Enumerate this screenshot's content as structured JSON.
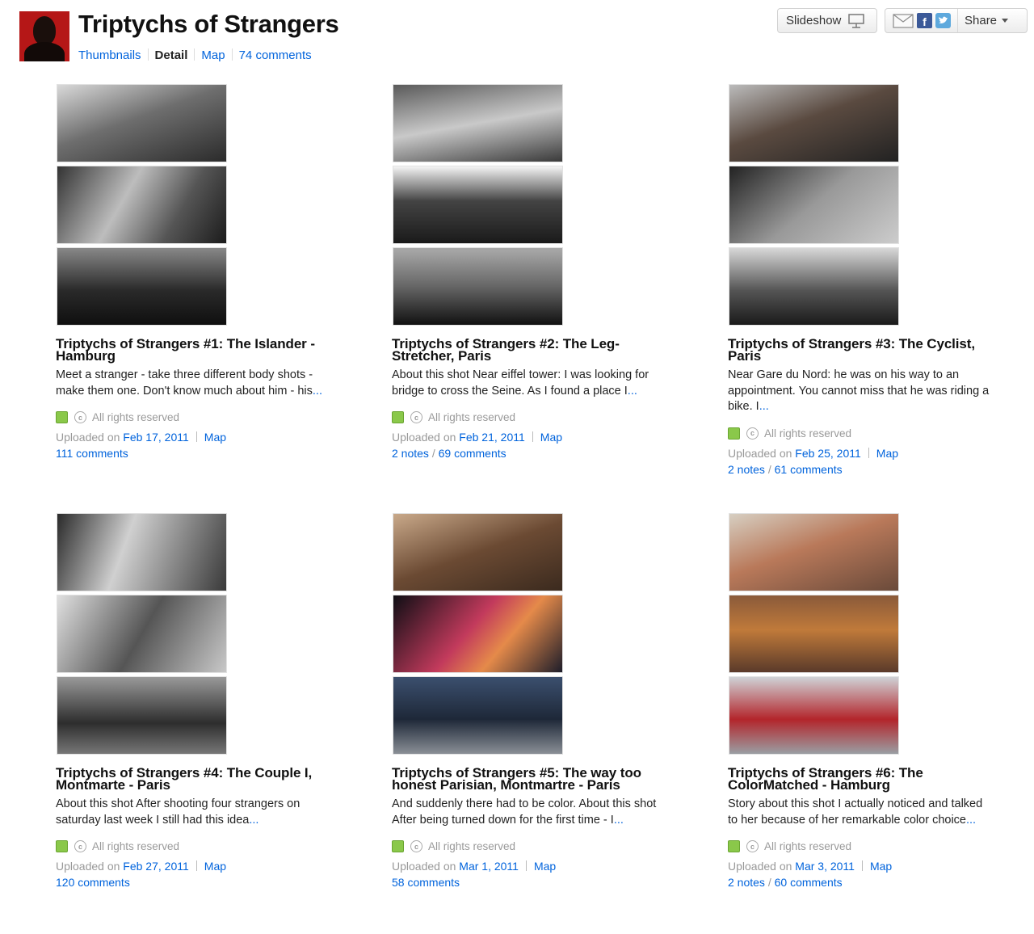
{
  "header": {
    "title": "Triptychs of Strangers",
    "nav": {
      "thumbnails": "Thumbnails",
      "detail": "Detail",
      "map": "Map",
      "comments": "74 comments"
    },
    "slideshow_label": "Slideshow",
    "share_label": "Share"
  },
  "license_text": "All rights reserved",
  "uploaded_prefix": "Uploaded on",
  "map_label": "Map",
  "cards": [
    {
      "title": "Triptychs of Strangers #1: The Islander - Hamburg",
      "desc": "Meet a stranger - take three different body shots - make them one. Don't know much about him - his",
      "more": "...",
      "date": "Feb 17, 2011",
      "notes": "",
      "comments": "111 comments"
    },
    {
      "title": "Triptychs of Strangers #2: The Leg-Stretcher, Paris",
      "desc": "About this shot Near eiffel tower: I was looking for bridge to cross the Seine. As I found a place I",
      "more": "...",
      "date": "Feb 21, 2011",
      "notes": "2 notes",
      "comments": "69 comments"
    },
    {
      "title": "Triptychs of Strangers #3: The Cyclist, Paris",
      "desc": "Near Gare du Nord: he was on his way to an appointment. You cannot miss that he was riding a bike. I",
      "more": "...",
      "date": "Feb 25, 2011",
      "notes": "2 notes",
      "comments": "61 comments"
    },
    {
      "title": "Triptychs of Strangers #4: The Couple I, Montmarte - Paris",
      "desc": "About this shot After shooting four strangers on saturday last week I still had this idea",
      "more": "...",
      "date": "Feb 27, 2011",
      "notes": "",
      "comments": "120 comments"
    },
    {
      "title": "Triptychs of Strangers #5: The way too honest Parisian, Montmartre - Paris",
      "desc": "And suddenly there had to be color. About this shot After being turned down for the first time - I",
      "more": "...",
      "date": "Mar 1, 2011",
      "notes": "",
      "comments": "58 comments"
    },
    {
      "title": "Triptychs of Strangers #6: The ColorMatched - Hamburg",
      "desc": "Story about this shot I actually noticed and talked to her because of her remarkable color choice",
      "more": "...",
      "date": "Mar 3, 2011",
      "notes": "2 notes",
      "comments": "60 comments"
    }
  ]
}
